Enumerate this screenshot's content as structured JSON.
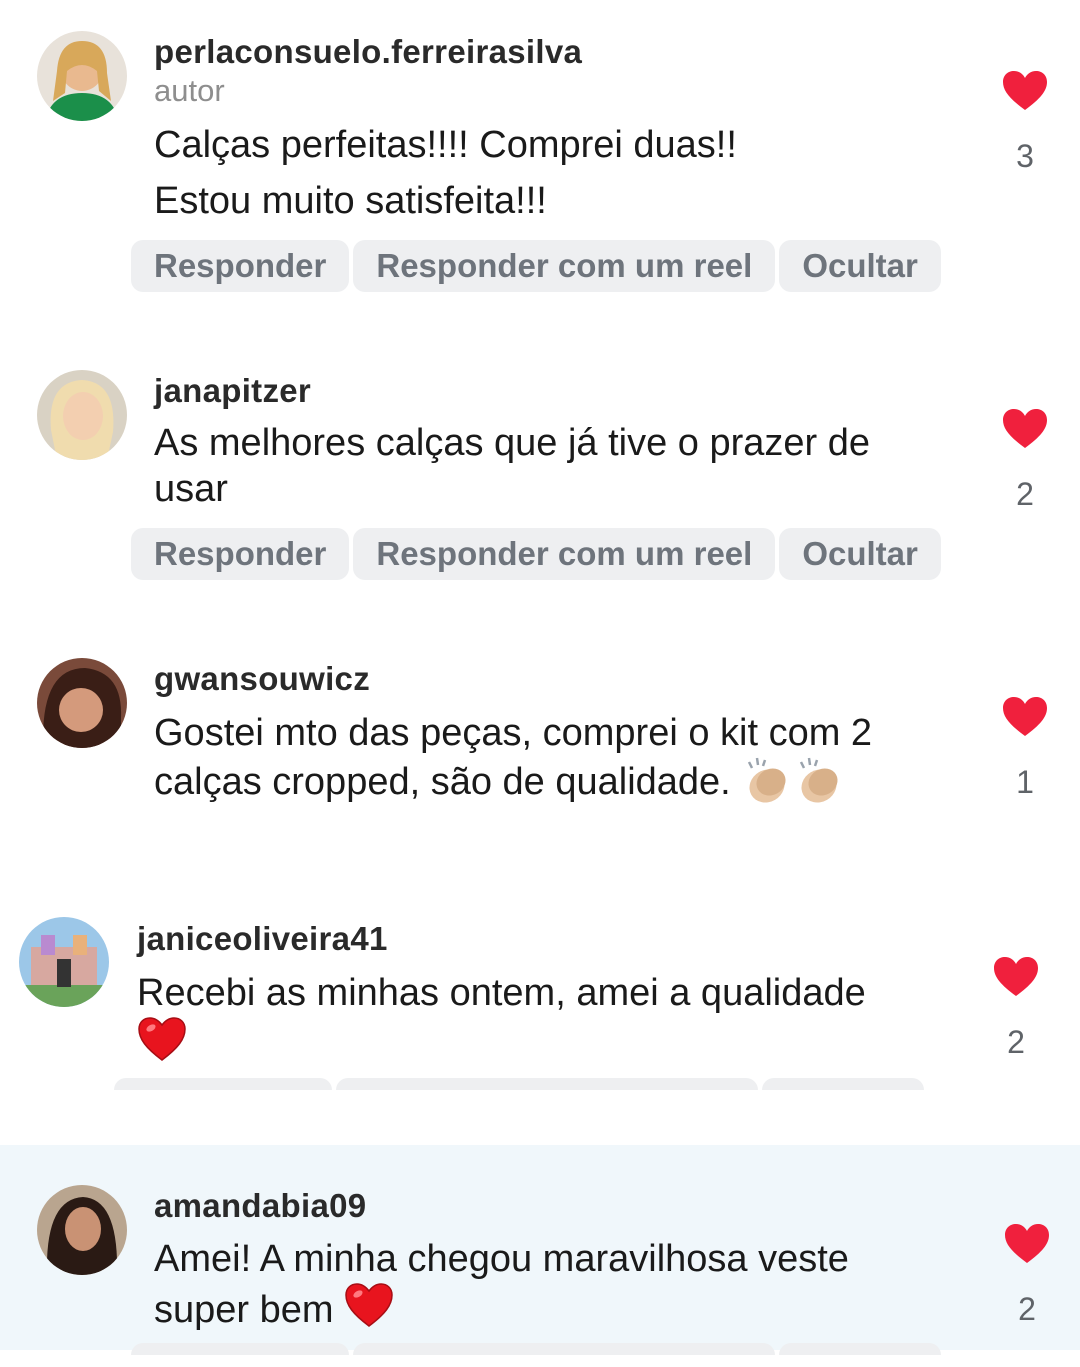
{
  "actions": {
    "reply": "Responder",
    "reply_reel": "Responder com um reel",
    "hide": "Ocultar"
  },
  "colors": {
    "like": "#f0203d",
    "pill_bg": "#eeeff1",
    "highlight_bg": "#f0f7fb"
  },
  "comments": [
    {
      "username": "perlaconsuelo.ferreirasilva",
      "badge": "autor",
      "lines": [
        "Calças perfeitas!!!! Comprei duas!!",
        "Estou muito satisfeita!!!"
      ],
      "likes": "3",
      "liked": true
    },
    {
      "username": "janapitzer",
      "lines": [
        "As melhores calças que já tive o prazer de",
        "usar"
      ],
      "likes": "2",
      "liked": true
    },
    {
      "username": "gwansouwicz",
      "lines": [
        "Gostei mto das peças, comprei o kit com 2",
        "calças cropped, são de qualidade."
      ],
      "emoji": "clapping-hands-icon",
      "likes": "1",
      "liked": true
    },
    {
      "username": "janiceoliveira41",
      "lines": [
        "Recebi as minhas ontem, amei a qualidade"
      ],
      "emoji": "red-heart-icon",
      "likes": "2",
      "liked": true
    },
    {
      "username": "amandabia09",
      "lines": [
        "Amei! A minha chegou maravilhosa veste",
        "super bem"
      ],
      "emoji": "red-heart-icon",
      "likes": "2",
      "liked": true
    }
  ]
}
